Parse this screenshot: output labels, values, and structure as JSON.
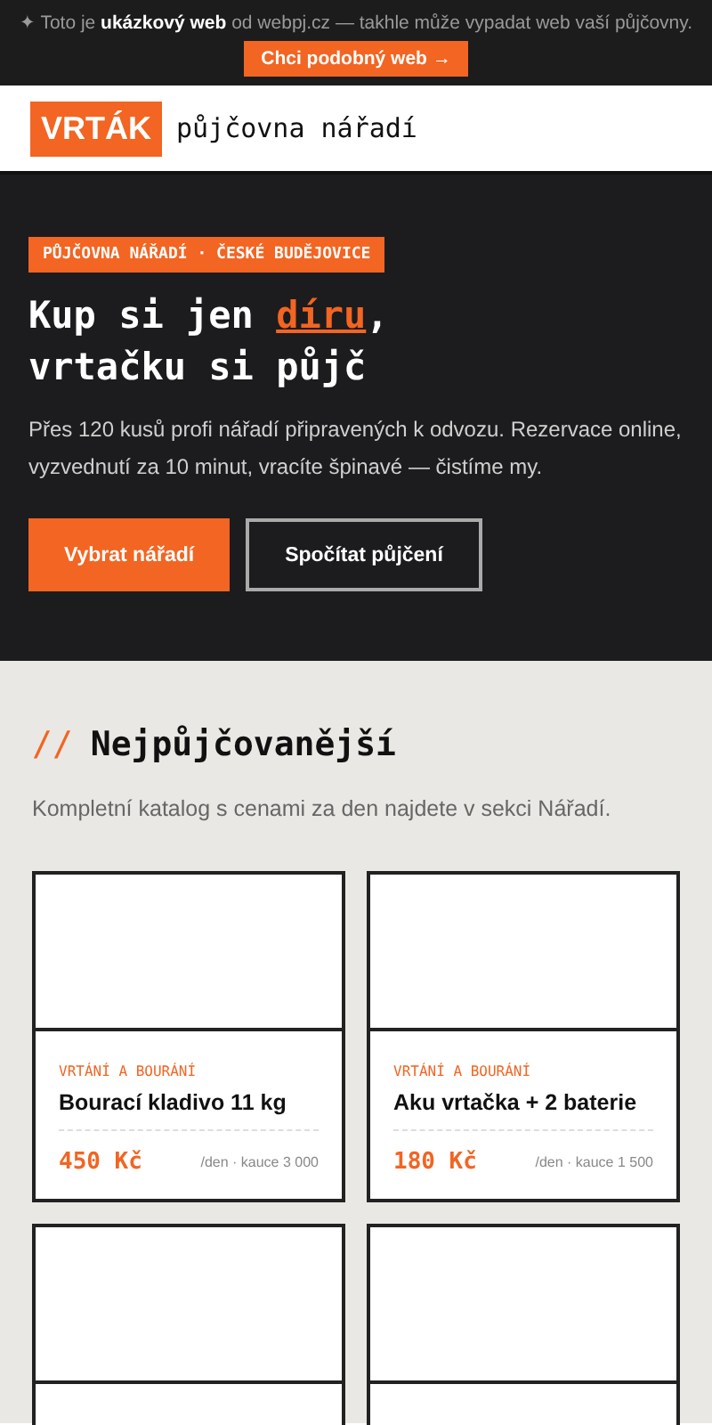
{
  "promo": {
    "icon": "✦",
    "text": "Toto je **ukázkový web** od webpj.cz — takhle může vypadat web vaší půjčovny.",
    "button": "Chci podobný web →"
  },
  "header": {
    "logo": "VRTÁK",
    "tagline": "půjčovna nářadí"
  },
  "hero": {
    "badge": "PŮJČOVNA NÁŘADÍ · ČESKÉ BUDĚJOVICE",
    "title_before": "Kup si jen ",
    "title_highlight": "díru",
    "title_after": ",",
    "title_line2": "vrtačku si půjč",
    "text": "Přes 120 kusů profi nářadí připravených k odvozu. Rezervace online, vyzvednutí za 10 minut, vracíte špinavé — čistíme my.",
    "buttons": [
      {
        "label": "Vybrat nářadí",
        "kind": "primary"
      },
      {
        "label": "Spočítat půjčení",
        "kind": "outline"
      }
    ]
  },
  "section": {
    "marker": "//",
    "title": "Nejpůjčovanější",
    "subtitle": "Kompletní katalog s cenami za den najdete v sekci Nářadí."
  },
  "products": [
    {
      "kind": "full",
      "category": "VRTÁNÍ A BOURÁNÍ",
      "name": "Bourací kladivo 11 kg",
      "price": "450 Kč",
      "terms": "/den · kauce 3 000"
    },
    {
      "kind": "full",
      "category": "VRTÁNÍ A BOURÁNÍ",
      "name": "Aku vrtačka + 2 baterie",
      "price": "180 Kč",
      "terms": "/den · kauce 1 500"
    },
    {
      "kind": "cut"
    },
    {
      "kind": "cut"
    }
  ]
}
